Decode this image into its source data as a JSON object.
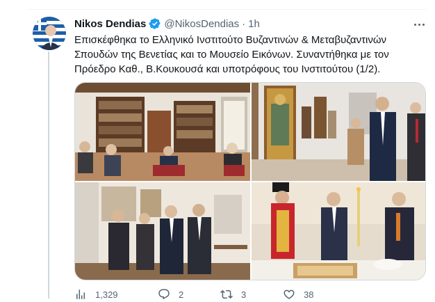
{
  "tweet": {
    "author_name": "Nikos Dendias",
    "handle": "@NikosDendias",
    "separator": "·",
    "time": "1h",
    "text_lines": [
      "Επισκέφθηκα το Ελληνικό Ινστιτούτο Βυζαντινών & Μεταβυζαντινών",
      "Σπουδών της Βενετίας και το Μουσείο Εικόνων. Συναντήθηκα με τον",
      "Πρόεδρο Καθ., Β.Κουκουσά και υποτρόφους του Ινστιτούτου (1/2)."
    ]
  },
  "icons": {
    "verified": "verified-badge-icon",
    "more": "more-dots-icon",
    "views": "analytics-icon",
    "reply": "reply-icon",
    "retweet": "retweet-icon",
    "like": "heart-icon"
  },
  "actions": {
    "views": "1,329",
    "replies": "2",
    "retweets": "3",
    "likes": "38"
  },
  "colors": {
    "accent": "#1d9bf0",
    "secondary_text": "#536471",
    "border": "#cfd9de"
  }
}
